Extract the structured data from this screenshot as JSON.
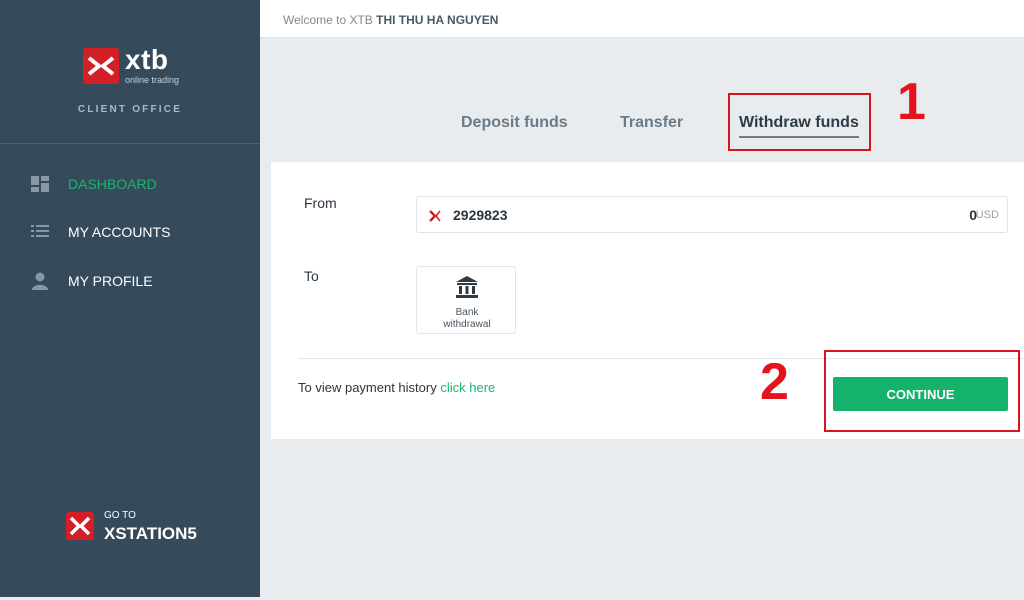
{
  "sidebar": {
    "logo_text": "xtb",
    "logo_sub": "online trading",
    "client_office": "CLIENT OFFICE",
    "items": [
      {
        "label": "DASHBOARD",
        "icon": "dashboard-icon",
        "active": true
      },
      {
        "label": "MY ACCOUNTS",
        "icon": "list-icon",
        "active": false
      },
      {
        "label": "MY PROFILE",
        "icon": "user-icon",
        "active": false
      }
    ],
    "goto_small": "GO TO",
    "goto_big": "XSTATION5"
  },
  "header": {
    "welcome_prefix": "Welcome to XTB ",
    "user_name": "THI THU HA NGUYEN"
  },
  "tabs": [
    {
      "label": "Deposit funds",
      "active": false
    },
    {
      "label": "Transfer",
      "active": false
    },
    {
      "label": "Withdraw funds",
      "active": true
    }
  ],
  "form": {
    "from_label": "From",
    "account_number": "2929823",
    "balance": "0",
    "currency": "USD",
    "to_label": "To",
    "bank_label_line1": "Bank",
    "bank_label_line2": "withdrawal",
    "history_text": "To view payment history ",
    "history_link": "click here",
    "continue_label": "CONTINUE"
  },
  "annotations": {
    "num1": "1",
    "num2": "2",
    "color": "#e3141d"
  },
  "colors": {
    "sidebar_bg": "#354a5a",
    "accent_green": "#1fb26e",
    "brand_red": "#d32027"
  }
}
